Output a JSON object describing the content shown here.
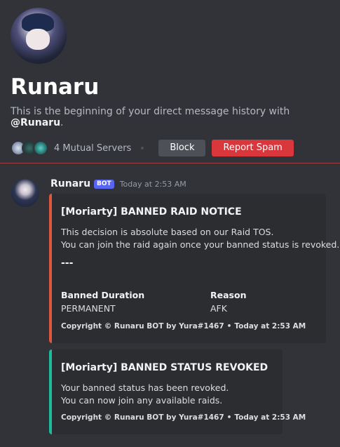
{
  "profile": {
    "name": "Runaru",
    "intro_prefix": "This is the beginning of your direct message history with ",
    "intro_mention": "@Runaru",
    "intro_suffix": ".",
    "mutual_servers": "4 Mutual Servers",
    "block_label": "Block",
    "report_label": "Report Spam"
  },
  "message": {
    "author": "Runaru",
    "bot_tag": "BOT",
    "time": "Today at 2:53 AM"
  },
  "embeds": [
    {
      "accent": "#e0573d",
      "title": "[Moriarty] BANNED RAID NOTICE",
      "description_lines": [
        "This decision is absolute based on our Raid TOS.",
        "You can join the raid again once your banned status is revoked."
      ],
      "separator": "---",
      "fields": [
        {
          "name": "Banned Duration",
          "value": "PERMANENT"
        },
        {
          "name": "Reason",
          "value": "AFK"
        }
      ],
      "footer_text": "Copyright © Runaru BOT by Yura#1467",
      "footer_dot": "•",
      "footer_time": "Today at 2:53 AM"
    },
    {
      "accent": "#1abc9c",
      "title": "[Moriarty] BANNED STATUS REVOKED",
      "description_lines": [
        "Your banned status has been revoked.",
        "You can now join any available raids."
      ],
      "footer_text": "Copyright © Runaru BOT by Yura#1467",
      "footer_dot": "•",
      "footer_time": "Today at 2:53 AM"
    }
  ]
}
